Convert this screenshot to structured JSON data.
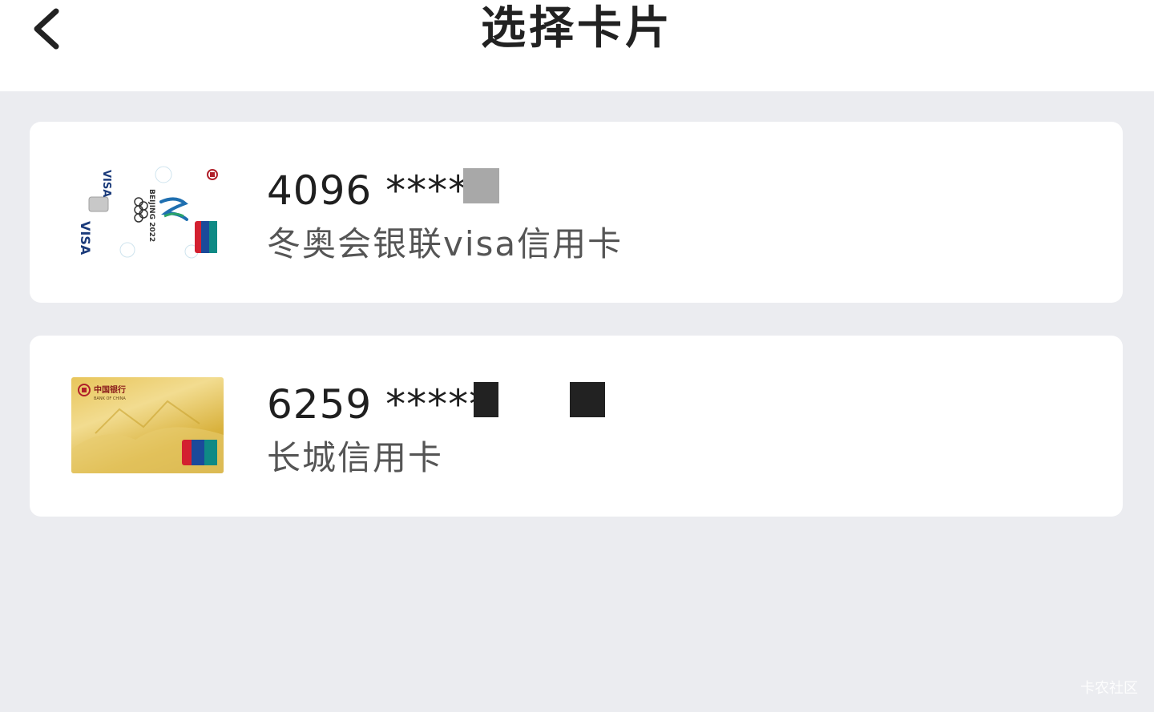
{
  "header": {
    "title": "选择卡片"
  },
  "cards": [
    {
      "number": "4096 *****",
      "name": "冬奥会银联visa信用卡",
      "thumb_text": [
        "VISA",
        "BEIJING 2022",
        "VISA",
        "UnionPay 银联"
      ]
    },
    {
      "number": "6259 *****",
      "name": "长城信用卡",
      "thumb_text": [
        "中国银行",
        "BANK OF CHINA",
        "UnionPay 银联"
      ]
    }
  ],
  "watermark": "卡农社区",
  "colors": {
    "background": "#ebecf0",
    "card_bg": "#ffffff",
    "title": "#222222",
    "subtitle": "#555555"
  }
}
